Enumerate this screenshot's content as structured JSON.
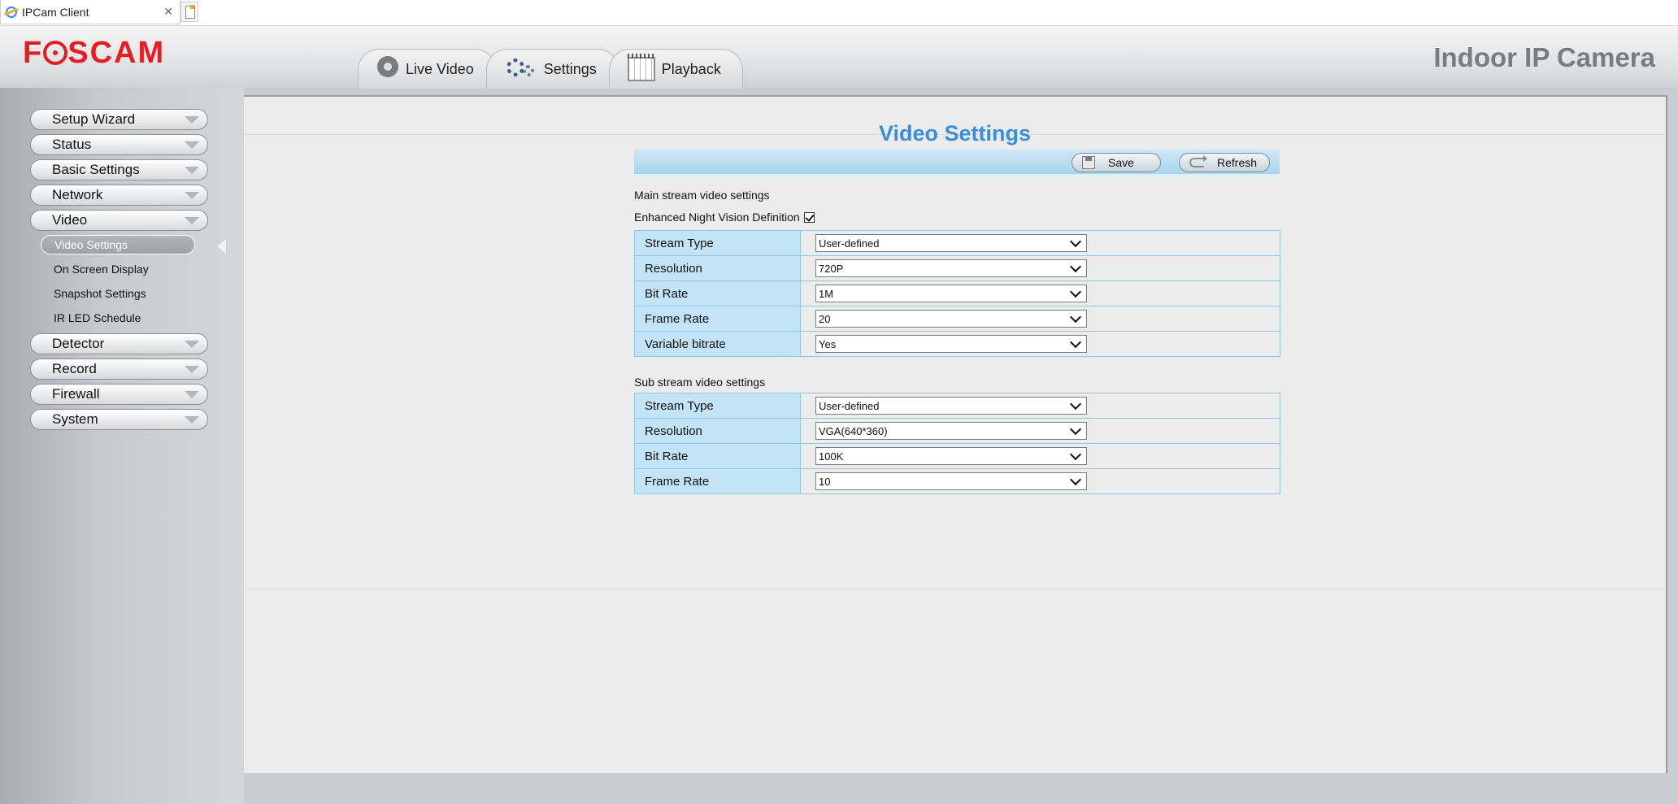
{
  "browser": {
    "tab_title": "IPCam Client",
    "close_glyph": "✕"
  },
  "header": {
    "logo_prefix": "F",
    "logo_suffix": "SCAM",
    "product_name": "Indoor IP Camera",
    "nav_tabs": [
      {
        "label": "Live Video",
        "icon": "webcam-icon"
      },
      {
        "label": "Settings",
        "icon": "gears-icon"
      },
      {
        "label": "Playback",
        "icon": "calendar-icon"
      }
    ]
  },
  "sidebar": {
    "menu": [
      {
        "label": "Setup Wizard"
      },
      {
        "label": "Status"
      },
      {
        "label": "Basic Settings"
      },
      {
        "label": "Network"
      },
      {
        "label": "Video"
      },
      {
        "label": "Detector"
      },
      {
        "label": "Record"
      },
      {
        "label": "Firewall"
      },
      {
        "label": "System"
      }
    ],
    "video_submenu": [
      {
        "label": "Video Settings",
        "active": true
      },
      {
        "label": "On Screen Display"
      },
      {
        "label": "Snapshot Settings"
      },
      {
        "label": "IR LED Schedule"
      }
    ]
  },
  "main": {
    "title": "Video Settings",
    "toolbar": {
      "save_label": "Save",
      "refresh_label": "Refresh"
    },
    "main_stream_heading": "Main stream video settings",
    "enhanced_night_vision": {
      "label": "Enhanced Night Vision Definition",
      "checked": true
    },
    "main_stream": [
      {
        "label": "Stream Type",
        "value": "User-defined"
      },
      {
        "label": "Resolution",
        "value": "720P"
      },
      {
        "label": "Bit Rate",
        "value": "1M"
      },
      {
        "label": "Frame Rate",
        "value": "20"
      },
      {
        "label": "Variable bitrate",
        "value": "Yes"
      }
    ],
    "sub_stream_heading": "Sub stream video settings",
    "sub_stream": [
      {
        "label": "Stream Type",
        "value": "User-defined"
      },
      {
        "label": "Resolution",
        "value": "VGA(640*360)"
      },
      {
        "label": "Bit Rate",
        "value": "100K"
      },
      {
        "label": "Frame Rate",
        "value": "10"
      }
    ]
  },
  "colors": {
    "brand_red": "#e21f26",
    "title_blue": "#3b8fd9",
    "label_cell_blue": "#c3e3f6"
  }
}
